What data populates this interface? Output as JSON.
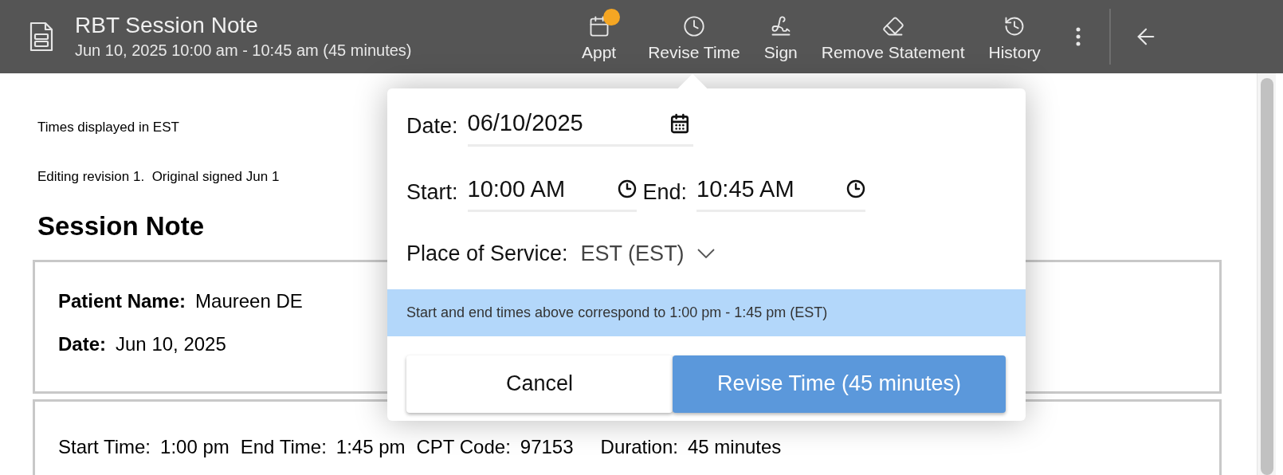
{
  "header": {
    "title": "RBT Session Note",
    "subtitle": "Jun 10, 2025 10:00 am - 10:45 am (45 minutes)",
    "actions": [
      {
        "label": "Appt",
        "notification": true
      },
      {
        "label": "Revise Time",
        "notification": false
      },
      {
        "label": "Sign",
        "notification": false
      },
      {
        "label": "Remove Statement",
        "notification": false
      },
      {
        "label": "History",
        "notification": false
      }
    ]
  },
  "page": {
    "timezone_note": "Times displayed in EST",
    "revision_note": "Editing revision 1.  Original signed Jun 1",
    "heading": "Session Note",
    "summary": [
      {
        "label": "Patient Name:",
        "value": "Maureen DE"
      },
      {
        "label": "Date:",
        "value": "Jun 10, 2025"
      }
    ],
    "details": [
      {
        "label": "Start Time:",
        "value": "1:00 pm"
      },
      {
        "label": "End Time:",
        "value": "1:45 pm"
      },
      {
        "label": "CPT Code:",
        "value": "97153"
      },
      {
        "label": "Duration:",
        "value": "45 minutes"
      }
    ]
  },
  "popover": {
    "date": {
      "label": "Date:",
      "value": "06/10/2025"
    },
    "start": {
      "label": "Start:",
      "value": "10:00 AM"
    },
    "end": {
      "label": "End:",
      "value": "10:45 AM"
    },
    "place_of_service": {
      "label": "Place of Service:",
      "value": "EST (EST)"
    },
    "banner": "Start and end times above correspond to 1:00 pm - 1:45 pm (EST)",
    "buttons": [
      {
        "label": "Cancel",
        "kind": "secondary"
      },
      {
        "label": "Revise Time (45 minutes)",
        "kind": "primary"
      }
    ]
  }
}
